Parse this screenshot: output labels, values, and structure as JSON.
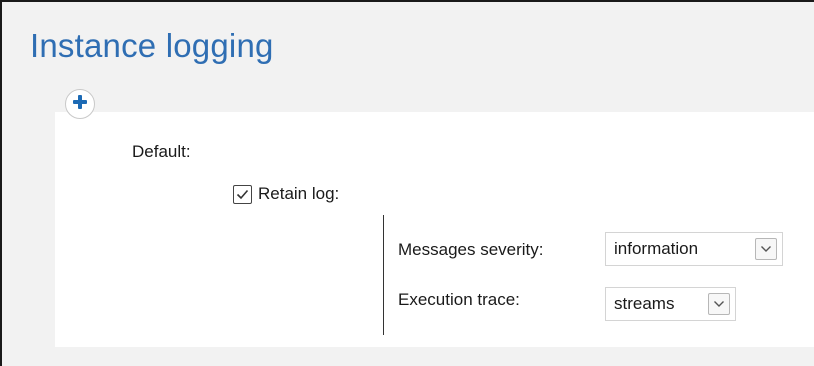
{
  "page": {
    "title": "Instance logging"
  },
  "toolbar": {
    "add_icon": "plus-icon"
  },
  "logging": {
    "default_label": "Default:",
    "retain_log": {
      "label": "Retain log:",
      "checked": true
    },
    "messages_severity": {
      "label": "Messages severity:",
      "value": "information"
    },
    "execution_trace": {
      "label": "Execution trace:",
      "value": "streams"
    }
  },
  "colors": {
    "title": "#2f6eb3",
    "add_icon": "#1c6ab5"
  }
}
